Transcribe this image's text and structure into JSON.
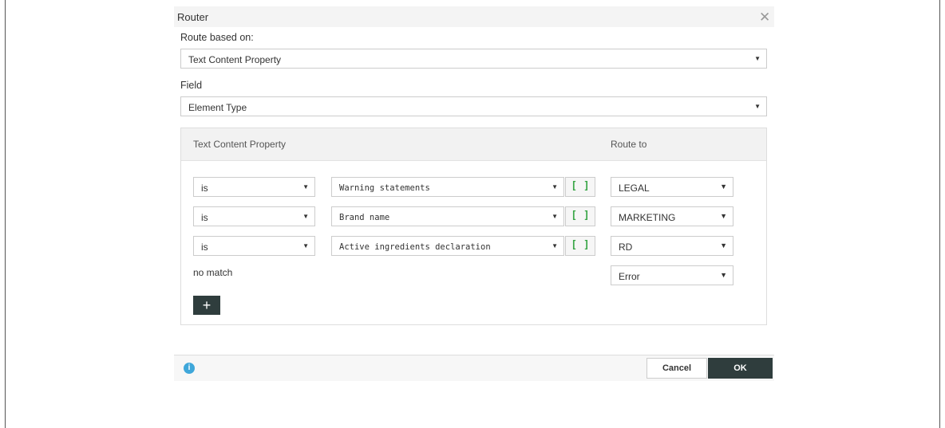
{
  "dialog": {
    "title": "Router",
    "close_icon": "close-icon"
  },
  "route_based_on": {
    "label": "Route based on:",
    "value": "Text Content Property"
  },
  "field": {
    "label": "Field",
    "value": "Element Type"
  },
  "table": {
    "col_property": "Text Content Property",
    "col_route": "Route to",
    "rows": [
      {
        "operator": "is",
        "value": "Warning statements",
        "route": "LEGAL"
      },
      {
        "operator": "is",
        "value": "Brand name",
        "route": "MARKETING"
      },
      {
        "operator": "is",
        "value": "Active ingredients declaration",
        "route": "RD"
      }
    ],
    "bracket_label": "[ ]",
    "no_match_label": "no match",
    "no_match_route": "Error",
    "add_label": "+"
  },
  "footer": {
    "info_icon": "info-icon",
    "cancel_label": "Cancel",
    "ok_label": "OK"
  },
  "colors": {
    "accent_dark": "#2f3d3d",
    "bracket_green": "#3aa648",
    "info_blue": "#3fa7da"
  }
}
